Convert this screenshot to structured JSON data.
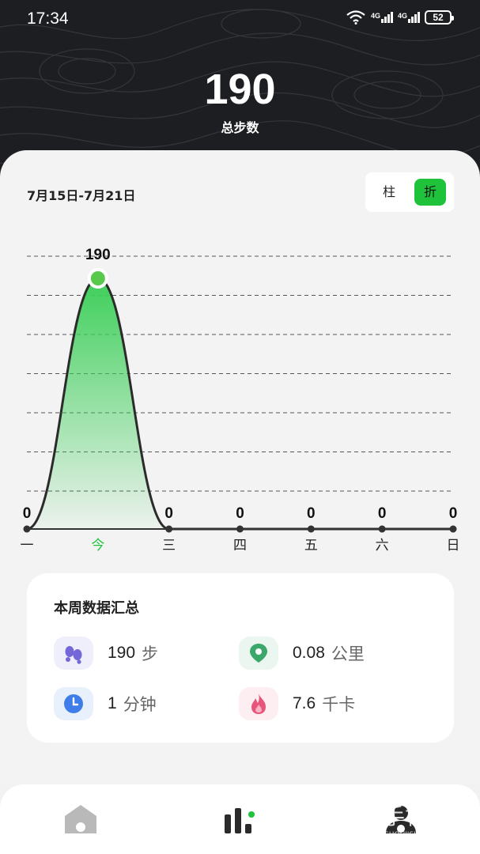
{
  "status_bar": {
    "time": "17:34",
    "battery": "52",
    "signal1": "4G",
    "signal2": "4G"
  },
  "header": {
    "total_value": "190",
    "total_label": "总步数"
  },
  "chart_panel": {
    "date_range": "7月15日-7月21日",
    "toggle": {
      "bar_label": "柱",
      "line_label": "折",
      "selected": "折"
    }
  },
  "chart_data": {
    "type": "area",
    "categories": [
      "一",
      "今",
      "三",
      "四",
      "五",
      "六",
      "日"
    ],
    "values": [
      0,
      190,
      0,
      0,
      0,
      0,
      0
    ],
    "data_labels": [
      "0",
      "190",
      "0",
      "0",
      "0",
      "0",
      "0"
    ],
    "highlight_index": 1,
    "grid": true,
    "ylim": [
      0,
      190
    ],
    "colors": {
      "area_top": "#3ecf5a",
      "line": "#2b2b2b",
      "highlight_label": "#1ec23b"
    }
  },
  "summary": {
    "title": "本周数据汇总",
    "stats": [
      {
        "icon": "footprints-icon",
        "value": "190",
        "unit": "步"
      },
      {
        "icon": "location-pin-icon",
        "value": "0.08",
        "unit": "公里"
      },
      {
        "icon": "clock-icon",
        "value": "1",
        "unit": "分钟"
      },
      {
        "icon": "flame-icon",
        "value": "7.6",
        "unit": "千卡"
      }
    ]
  },
  "bottom_nav": {
    "items": [
      {
        "icon": "home-icon"
      },
      {
        "icon": "stats-icon"
      },
      {
        "icon": "profile-icon"
      }
    ]
  },
  "colors": {
    "accent": "#1ec23b",
    "header_bg": "#1d1e22"
  }
}
